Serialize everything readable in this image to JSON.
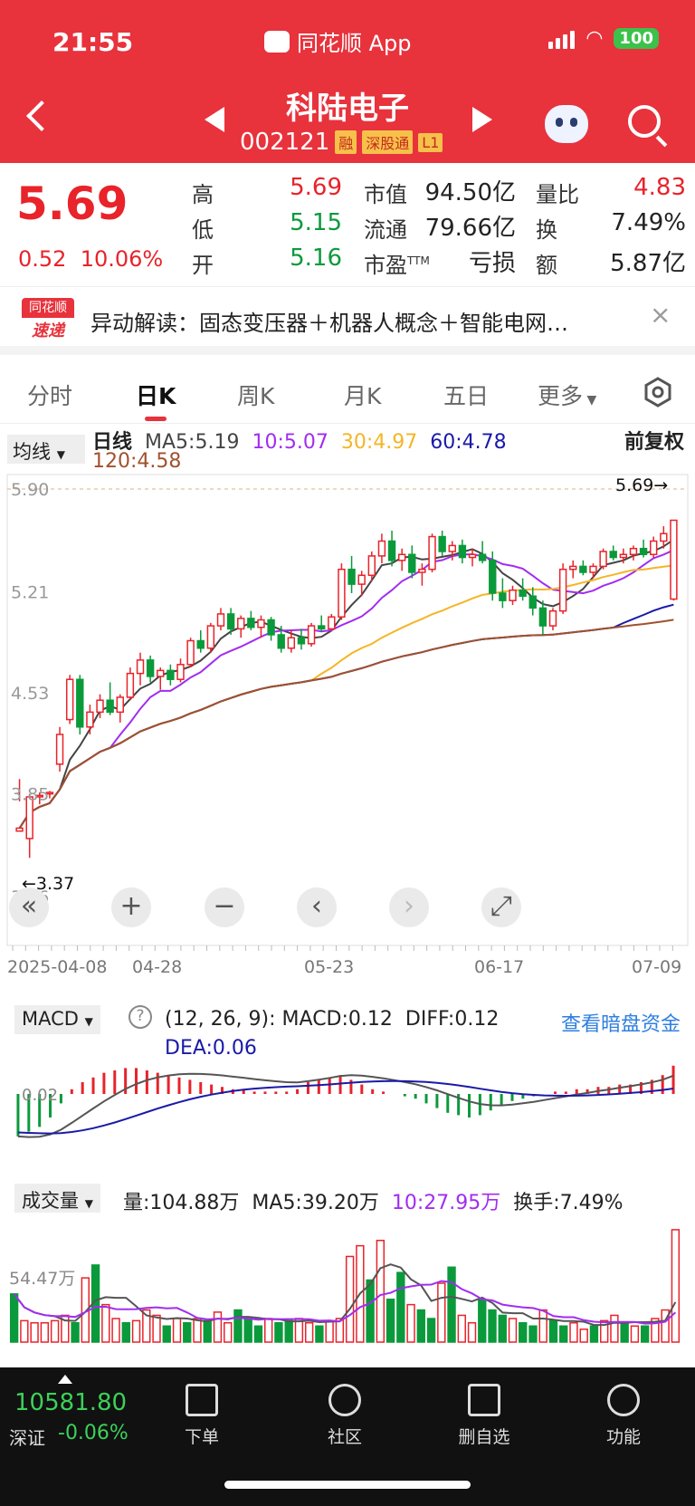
{
  "status_bar": {
    "time": "21:55",
    "app_name": "同花顺 App",
    "battery": "100"
  },
  "header": {
    "name": "科陆电子",
    "code": "002121",
    "tags": [
      "融",
      "深股通",
      "L1"
    ]
  },
  "quote": {
    "price": "5.69",
    "change": "0.52",
    "change_pct": "10.06%",
    "high_label": "高",
    "high": "5.69",
    "low_label": "低",
    "low": "5.15",
    "open_label": "开",
    "open": "5.16",
    "mcap_label": "市值",
    "mcap": "94.50亿",
    "float_label": "流通",
    "float": "79.66亿",
    "pe_label": "市盈",
    "pe_sup": "TTM",
    "pe": "亏损",
    "vr_label": "量比",
    "vr": "4.83",
    "turn_label": "换",
    "turn": "7.49%",
    "amt_label": "额",
    "amt": "5.87亿"
  },
  "notice": {
    "logo_top": "同花顺",
    "logo_bottom": "速递",
    "text": "异动解读：固态变压器＋机器人概念＋智能电网…"
  },
  "tabs": [
    "分时",
    "日K",
    "周K",
    "月K",
    "五日",
    "更多"
  ],
  "ma_bar": {
    "btn": "均线",
    "title": "日线",
    "ma5": "MA5:5.19",
    "ma10": "10:5.07",
    "ma30": "30:4.97",
    "ma60": "60:4.78",
    "ma120": "120:4.58",
    "adjust": "前复权"
  },
  "colors": {
    "up": "#e8232a",
    "down": "#0a9a3b",
    "ma5": "#444444",
    "ma10": "#a12df0",
    "ma30": "#f5b526",
    "ma60": "#1a1aa8",
    "ma120": "#a0522d"
  },
  "chart_data": [
    {
      "type": "candlestick",
      "y_ticks": [
        "5.90",
        "5.21",
        "4.53",
        "3.85",
        "3.16"
      ],
      "ylim": [
        3.16,
        5.9
      ],
      "x_ticks": [
        "2025-04-08",
        "04-28",
        "05-23",
        "06-17",
        "07-09"
      ],
      "max_marker": "5.69→",
      "min_marker": "←3.37",
      "candles": [
        [
          3.6,
          3.95,
          3.8,
          3.62
        ],
        [
          3.55,
          3.85,
          3.42,
          3.83
        ],
        [
          3.83,
          3.86,
          3.78,
          3.84
        ],
        [
          3.85,
          3.87,
          3.82,
          3.86
        ],
        [
          4.05,
          4.3,
          4.0,
          4.25
        ],
        [
          4.35,
          4.65,
          4.32,
          4.62
        ],
        [
          4.62,
          4.65,
          4.25,
          4.3
        ],
        [
          4.3,
          4.45,
          4.25,
          4.4
        ],
        [
          4.4,
          4.52,
          4.36,
          4.48
        ],
        [
          4.48,
          4.6,
          4.38,
          4.4
        ],
        [
          4.4,
          4.52,
          4.33,
          4.5
        ],
        [
          4.5,
          4.7,
          4.48,
          4.66
        ],
        [
          4.66,
          4.8,
          4.58,
          4.75
        ],
        [
          4.75,
          4.78,
          4.6,
          4.64
        ],
        [
          4.64,
          4.7,
          4.55,
          4.68
        ],
        [
          4.68,
          4.72,
          4.58,
          4.62
        ],
        [
          4.62,
          4.76,
          4.6,
          4.72
        ],
        [
          4.72,
          4.9,
          4.7,
          4.88
        ],
        [
          4.88,
          4.95,
          4.8,
          4.83
        ],
        [
          4.83,
          5.0,
          4.8,
          4.98
        ],
        [
          4.98,
          5.1,
          4.95,
          5.06
        ],
        [
          5.06,
          5.1,
          4.92,
          4.96
        ],
        [
          4.96,
          5.05,
          4.9,
          5.03
        ],
        [
          5.03,
          5.08,
          4.95,
          4.97
        ],
        [
          4.97,
          5.05,
          4.9,
          5.02
        ],
        [
          5.02,
          5.04,
          4.88,
          4.92
        ],
        [
          4.92,
          4.98,
          4.8,
          4.83
        ],
        [
          4.83,
          4.95,
          4.8,
          4.9
        ],
        [
          4.9,
          4.96,
          4.82,
          4.86
        ],
        [
          4.86,
          5.0,
          4.84,
          4.98
        ],
        [
          4.98,
          5.05,
          4.94,
          4.96
        ],
        [
          4.96,
          5.06,
          4.95,
          5.04
        ],
        [
          5.04,
          5.4,
          5.02,
          5.36
        ],
        [
          5.36,
          5.45,
          5.2,
          5.26
        ],
        [
          5.26,
          5.35,
          5.18,
          5.32
        ],
        [
          5.32,
          5.48,
          5.28,
          5.45
        ],
        [
          5.45,
          5.6,
          5.4,
          5.55
        ],
        [
          5.55,
          5.62,
          5.38,
          5.42
        ],
        [
          5.42,
          5.5,
          5.35,
          5.46
        ],
        [
          5.46,
          5.52,
          5.3,
          5.34
        ],
        [
          5.34,
          5.4,
          5.25,
          5.36
        ],
        [
          5.36,
          5.6,
          5.34,
          5.58
        ],
        [
          5.58,
          5.62,
          5.45,
          5.48
        ],
        [
          5.48,
          5.55,
          5.42,
          5.52
        ],
        [
          5.52,
          5.56,
          5.4,
          5.44
        ],
        [
          5.44,
          5.5,
          5.38,
          5.46
        ],
        [
          5.46,
          5.55,
          5.4,
          5.42
        ],
        [
          5.42,
          5.48,
          5.15,
          5.2
        ],
        [
          5.2,
          5.3,
          5.1,
          5.15
        ],
        [
          5.15,
          5.25,
          5.12,
          5.22
        ],
        [
          5.22,
          5.3,
          5.15,
          5.18
        ],
        [
          5.18,
          5.24,
          5.05,
          5.1
        ],
        [
          5.1,
          5.15,
          4.92,
          4.98
        ],
        [
          4.98,
          5.1,
          4.95,
          5.08
        ],
        [
          5.08,
          5.4,
          5.06,
          5.36
        ],
        [
          5.36,
          5.42,
          5.3,
          5.38
        ],
        [
          5.38,
          5.42,
          5.32,
          5.34
        ],
        [
          5.34,
          5.4,
          5.3,
          5.38
        ],
        [
          5.38,
          5.5,
          5.36,
          5.48
        ],
        [
          5.48,
          5.52,
          5.42,
          5.44
        ],
        [
          5.44,
          5.5,
          5.4,
          5.46
        ],
        [
          5.46,
          5.52,
          5.42,
          5.5
        ],
        [
          5.5,
          5.56,
          5.44,
          5.46
        ],
        [
          5.46,
          5.58,
          5.44,
          5.55
        ],
        [
          5.55,
          5.65,
          5.5,
          5.6
        ],
        [
          5.16,
          5.69,
          5.15,
          5.69
        ]
      ]
    },
    {
      "type": "bar",
      "panel": "MACD",
      "btn": "MACD",
      "params": "(12, 26, 9):",
      "macd": "MACD:0.12",
      "diff": "DIFF:0.12",
      "dea": "DEA:0.06",
      "link": "查看暗盘资金",
      "zero_tick": "0.02",
      "values": [
        -0.18,
        -0.16,
        -0.14,
        -0.1,
        -0.04,
        0.02,
        0.05,
        0.07,
        0.09,
        0.1,
        0.11,
        0.11,
        0.1,
        0.09,
        0.08,
        0.07,
        0.06,
        0.05,
        0.04,
        0.03,
        0.02,
        0.02,
        0.01,
        0.01,
        0.01,
        0.01,
        0.02,
        0.05,
        0.06,
        0.07,
        0.08,
        0.06,
        0.04,
        0.02,
        0.01,
        0.0,
        -0.01,
        -0.02,
        -0.04,
        -0.06,
        -0.08,
        -0.09,
        -0.1,
        -0.09,
        -0.07,
        -0.05,
        -0.03,
        -0.02,
        -0.01,
        0.0,
        0.01,
        0.01,
        0.02,
        0.02,
        0.03,
        0.03,
        0.04,
        0.04,
        0.05,
        0.06,
        0.08,
        0.12
      ]
    },
    {
      "type": "bar",
      "panel": "volume",
      "btn": "成交量",
      "vol": "量:104.88万",
      "ma5": "MA5:39.20万",
      "ma10": "10:27.95万",
      "turnover": "换手:7.49%",
      "tick": "54.47万",
      "values": [
        45,
        20,
        18,
        18,
        20,
        25,
        18,
        60,
        72,
        35,
        22,
        18,
        20,
        30,
        25,
        15,
        22,
        18,
        22,
        20,
        28,
        18,
        30,
        22,
        15,
        22,
        18,
        20,
        22,
        18,
        15,
        20,
        22,
        80,
        90,
        58,
        95,
        40,
        65,
        35,
        30,
        22,
        55,
        70,
        25,
        18,
        40,
        30,
        25,
        22,
        18,
        15,
        30,
        20,
        15,
        18,
        12,
        15,
        20,
        25,
        18,
        15,
        15,
        22,
        30,
        105
      ],
      "ups": [
        0,
        1,
        1,
        1,
        1,
        1,
        0,
        1,
        0,
        1,
        1,
        0,
        1,
        1,
        1,
        0,
        1,
        0,
        1,
        0,
        1,
        1,
        0,
        0,
        0,
        1,
        0,
        0,
        1,
        1,
        0,
        1,
        1,
        1,
        1,
        0,
        1,
        0,
        0,
        1,
        0,
        0,
        1,
        0,
        1,
        1,
        0,
        0,
        0,
        1,
        0,
        0,
        1,
        0,
        0,
        1,
        1,
        0,
        1,
        1,
        0,
        1,
        0,
        1,
        1,
        1
      ]
    }
  ],
  "controls": [
    "«",
    "+",
    "−",
    "‹",
    "›",
    "⤢"
  ],
  "index": {
    "value": "10581.80",
    "name": "深证",
    "change": "-0.06%"
  },
  "bottom_nav": [
    "下单",
    "社区",
    "删自选",
    "功能"
  ]
}
